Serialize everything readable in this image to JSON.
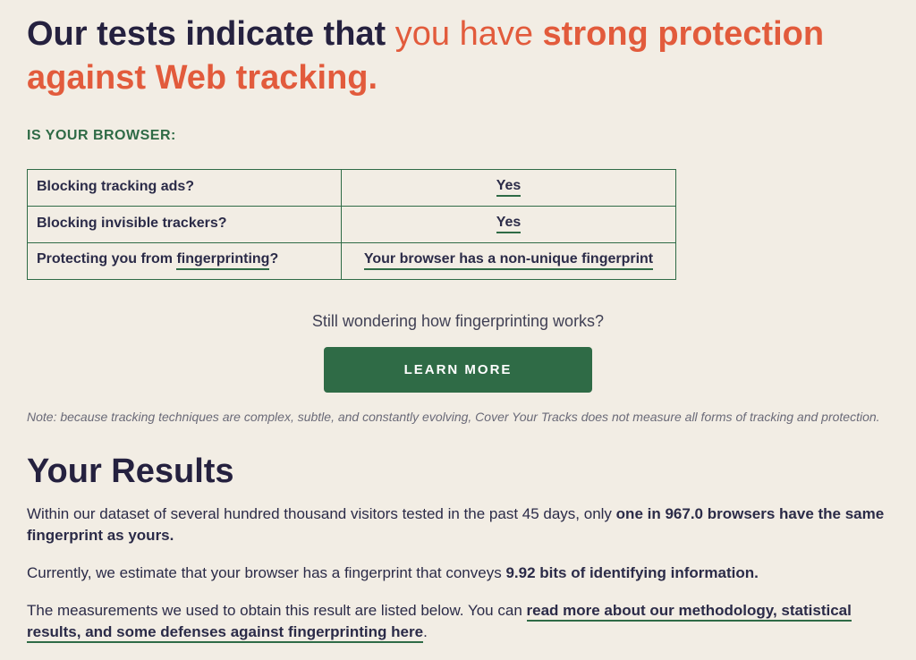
{
  "headline": {
    "pre": "Our tests indicate that ",
    "mid_normal": "you have ",
    "bold1": "strong protection",
    "sep": " ",
    "bold2": "against Web tracking",
    "after": "."
  },
  "subhead": "IS YOUR BROWSER:",
  "table": {
    "rows": [
      {
        "q_pre": "Blocking tracking ads?",
        "q_link": "",
        "q_post": "",
        "v": "Yes"
      },
      {
        "q_pre": "Blocking invisible trackers?",
        "q_link": "",
        "q_post": "",
        "v": "Yes"
      },
      {
        "q_pre": "Protecting you from ",
        "q_link": "fingerprinting",
        "q_post": "?",
        "v": "Your browser has a non-unique fingerprint"
      }
    ]
  },
  "cta": {
    "wonder": "Still wondering how fingerprinting works?",
    "button": "LEARN MORE"
  },
  "note": "Note: because tracking techniques are complex, subtle, and constantly evolving, Cover Your Tracks does not measure all forms of tracking and protection.",
  "results": {
    "title": "Your Results",
    "p1_pre": "Within our dataset of several hundred thousand visitors tested in the past 45 days, only ",
    "p1_bold": "one in 967.0 browsers have the same fingerprint as yours.",
    "p2_pre": "Currently, we estimate that your browser has a fingerprint that conveys ",
    "p2_bold": "9.92 bits of identifying information.",
    "p3_pre": "The measurements we used to obtain this result are listed below. You can ",
    "p3_link": "read more about our methodology, statistical results, and some defenses against fingerprinting here",
    "p3_after": "."
  }
}
